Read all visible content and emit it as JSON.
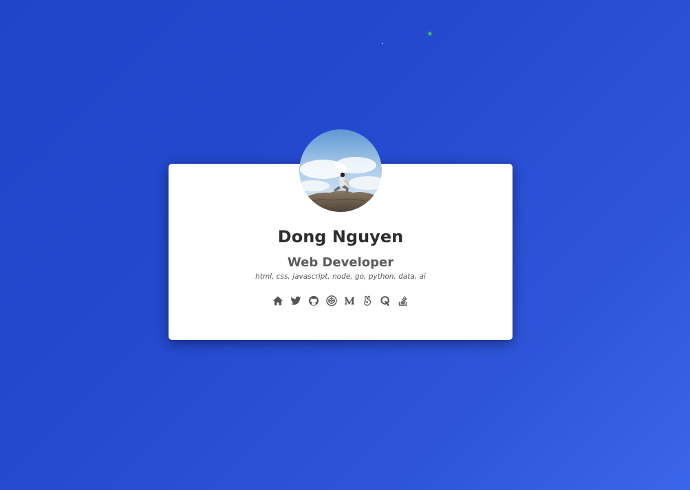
{
  "profile": {
    "name": "Dong Nguyen",
    "role": "Web Developer",
    "skills": "html, css, javascript, node, go, python, data, ai"
  },
  "social_links": [
    {
      "icon": "home-icon"
    },
    {
      "icon": "twitter-icon"
    },
    {
      "icon": "github-icon"
    },
    {
      "icon": "codepen-icon"
    },
    {
      "icon": "medium-icon"
    },
    {
      "icon": "angellist-icon"
    },
    {
      "icon": "quora-icon"
    },
    {
      "icon": "stackoverflow-icon"
    }
  ],
  "colors": {
    "background_start": "#1f45c8",
    "background_end": "#3b65ea",
    "card": "#ffffff",
    "name_text": "#2e2e2e",
    "icon": "#555555"
  }
}
